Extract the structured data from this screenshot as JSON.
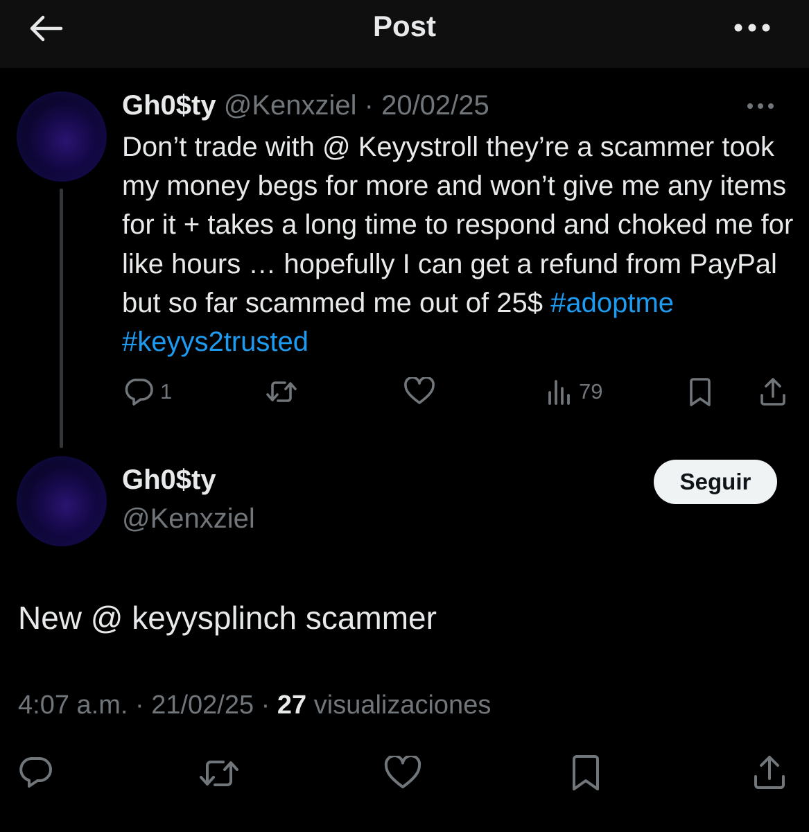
{
  "header": {
    "title": "Post"
  },
  "reply_tweet": {
    "display_name": "Gh0$ty",
    "handle": "@Kenxziel",
    "separator": " · ",
    "date": "20/02/25",
    "text_before_tags": "Don’t trade with @ Keyystroll  they’re a scammer took my money begs for more and won’t give me any items for it + takes a long time to respond and choked me for like hours … hopefully I can get a refund from PayPal but so far scammed me out of 25$ ",
    "hashtags": [
      "#adoptme",
      "#keyys2trusted"
    ],
    "actions": {
      "reply_count": "1",
      "retweet_count": "",
      "like_count": "",
      "views_count": "79"
    }
  },
  "main_tweet": {
    "display_name": "Gh0$ty",
    "handle": "@Kenxziel",
    "follow_label": "Seguir",
    "text": "New @ keyysplinch scammer",
    "time": "4:07 a.m.",
    "separator": " · ",
    "date": "21/02/25",
    "views_count": "27",
    "views_label": "visualizaciones"
  },
  "colors": {
    "background": "#000000",
    "header_background": "#0f0f0f",
    "text_primary": "#e7e9ea",
    "text_secondary": "#71767b",
    "accent": "#1d9bf0",
    "follow_button": "#eff3f4"
  },
  "icons": {
    "back": "arrow-left-icon",
    "more": "more-horizontal-icon",
    "reply": "reply-bubble-icon",
    "retweet": "retweet-icon",
    "like": "heart-icon",
    "views": "bar-chart-icon",
    "bookmark": "bookmark-icon",
    "share": "share-icon"
  }
}
